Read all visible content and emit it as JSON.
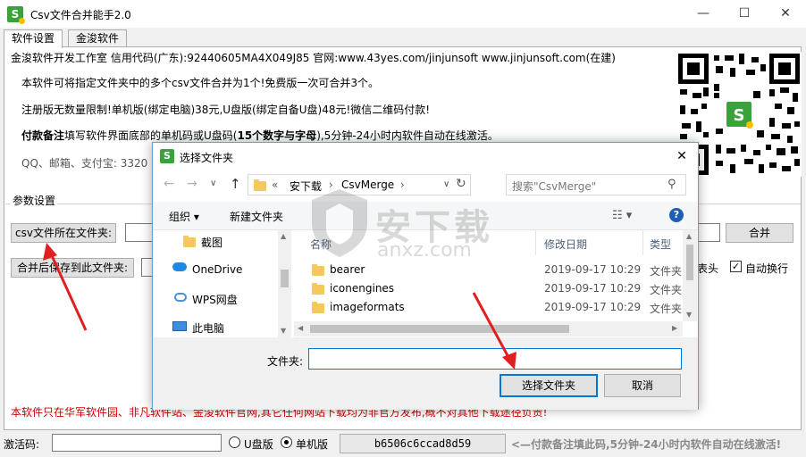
{
  "window": {
    "title": "Csv文件合并能手2.0",
    "icon_letter": "S",
    "controls": [
      "—",
      "☐",
      "✕"
    ]
  },
  "tabs": [
    {
      "label": "软件设置",
      "active": true
    },
    {
      "label": "金浚软件",
      "active": false
    }
  ],
  "info": {
    "line1": "金浚软件开发工作室  信用代码(广东):92440605MA4X049J85 官网:www.43yes.com/jinjunsoft  www.jinjunsoft.com(在建)",
    "line2": "本软件可将指定文件夹中的多个csv文件合并为1个!免费版一次可合并3个。",
    "line3": "注册版无数量限制!单机版(绑定电脑)38元,U盘版(绑定自备U盘)48元!微信二维码付款!",
    "line4_bold": "付款备注",
    "line4_rest": "填写软件界面底部的单机码或U盘码(",
    "line4_bold2": "15个数字与字母",
    "line4_end": "),5分钟-24小时内软件自动在线激活。",
    "line5": "QQ、邮箱、支付宝: 3320",
    "qr_alt": "qr-code"
  },
  "params": {
    "group_label": "参数设置",
    "source_folder_button": "csv文件所在文件夹:",
    "source_folder_value": "",
    "merge_button": "合并",
    "save_folder_button": "合并后保存到此文件夹:",
    "save_folder_value": "",
    "header_option": "表头",
    "header_checked": true,
    "wrap_option": "自动换行",
    "wrap_checked": true,
    "notice": "本软件只在华军软件园、非凡软件站、金浚软件官网,其它任何网站下载均为非官方发布,概不对其他下载途径负责!"
  },
  "bottom": {
    "activation_label": "激活码:",
    "activation_value": "",
    "usb_option": "U盘版",
    "usb_selected": false,
    "pc_option": "单机版",
    "pc_selected": true,
    "machine_code": "b6506c6ccad8d59",
    "hint": "<—付款备注填此码,5分钟-24小时内软件自动在线激活!"
  },
  "dialog": {
    "title": "选择文件夹",
    "close": "✕",
    "path": [
      "«",
      "安下载",
      "›",
      "CsvMerge",
      "›"
    ],
    "search_placeholder": "搜索\"CsvMerge\"",
    "organize": "组织 ▾",
    "new_folder": "新建文件夹",
    "nav_items": [
      {
        "label": "截图",
        "icon": "folder-icon"
      },
      {
        "label": "OneDrive",
        "icon": "cloud-icon"
      },
      {
        "label": "WPS网盘",
        "icon": "cloud-sync-icon"
      },
      {
        "label": "此电脑",
        "icon": "computer-icon"
      }
    ],
    "columns": [
      "名称",
      "修改日期",
      "类型"
    ],
    "files": [
      {
        "name": "bearer",
        "date": "2019-09-17 10:29",
        "type": "文件夹"
      },
      {
        "name": "iconengines",
        "date": "2019-09-17 10:29",
        "type": "文件夹"
      },
      {
        "name": "imageformats",
        "date": "2019-09-17 10:29",
        "type": "文件夹"
      }
    ],
    "folder_label": "文件夹:",
    "folder_value": "",
    "select_button": "选择文件夹",
    "cancel_button": "取消"
  },
  "watermark": {
    "text": "安下载",
    "sub": "anxz.com"
  },
  "colors": {
    "accent_blue": "#0078d7",
    "notice_red": "#d00000",
    "arrow_red": "#e02020",
    "help_blue": "#1a5fb4"
  }
}
